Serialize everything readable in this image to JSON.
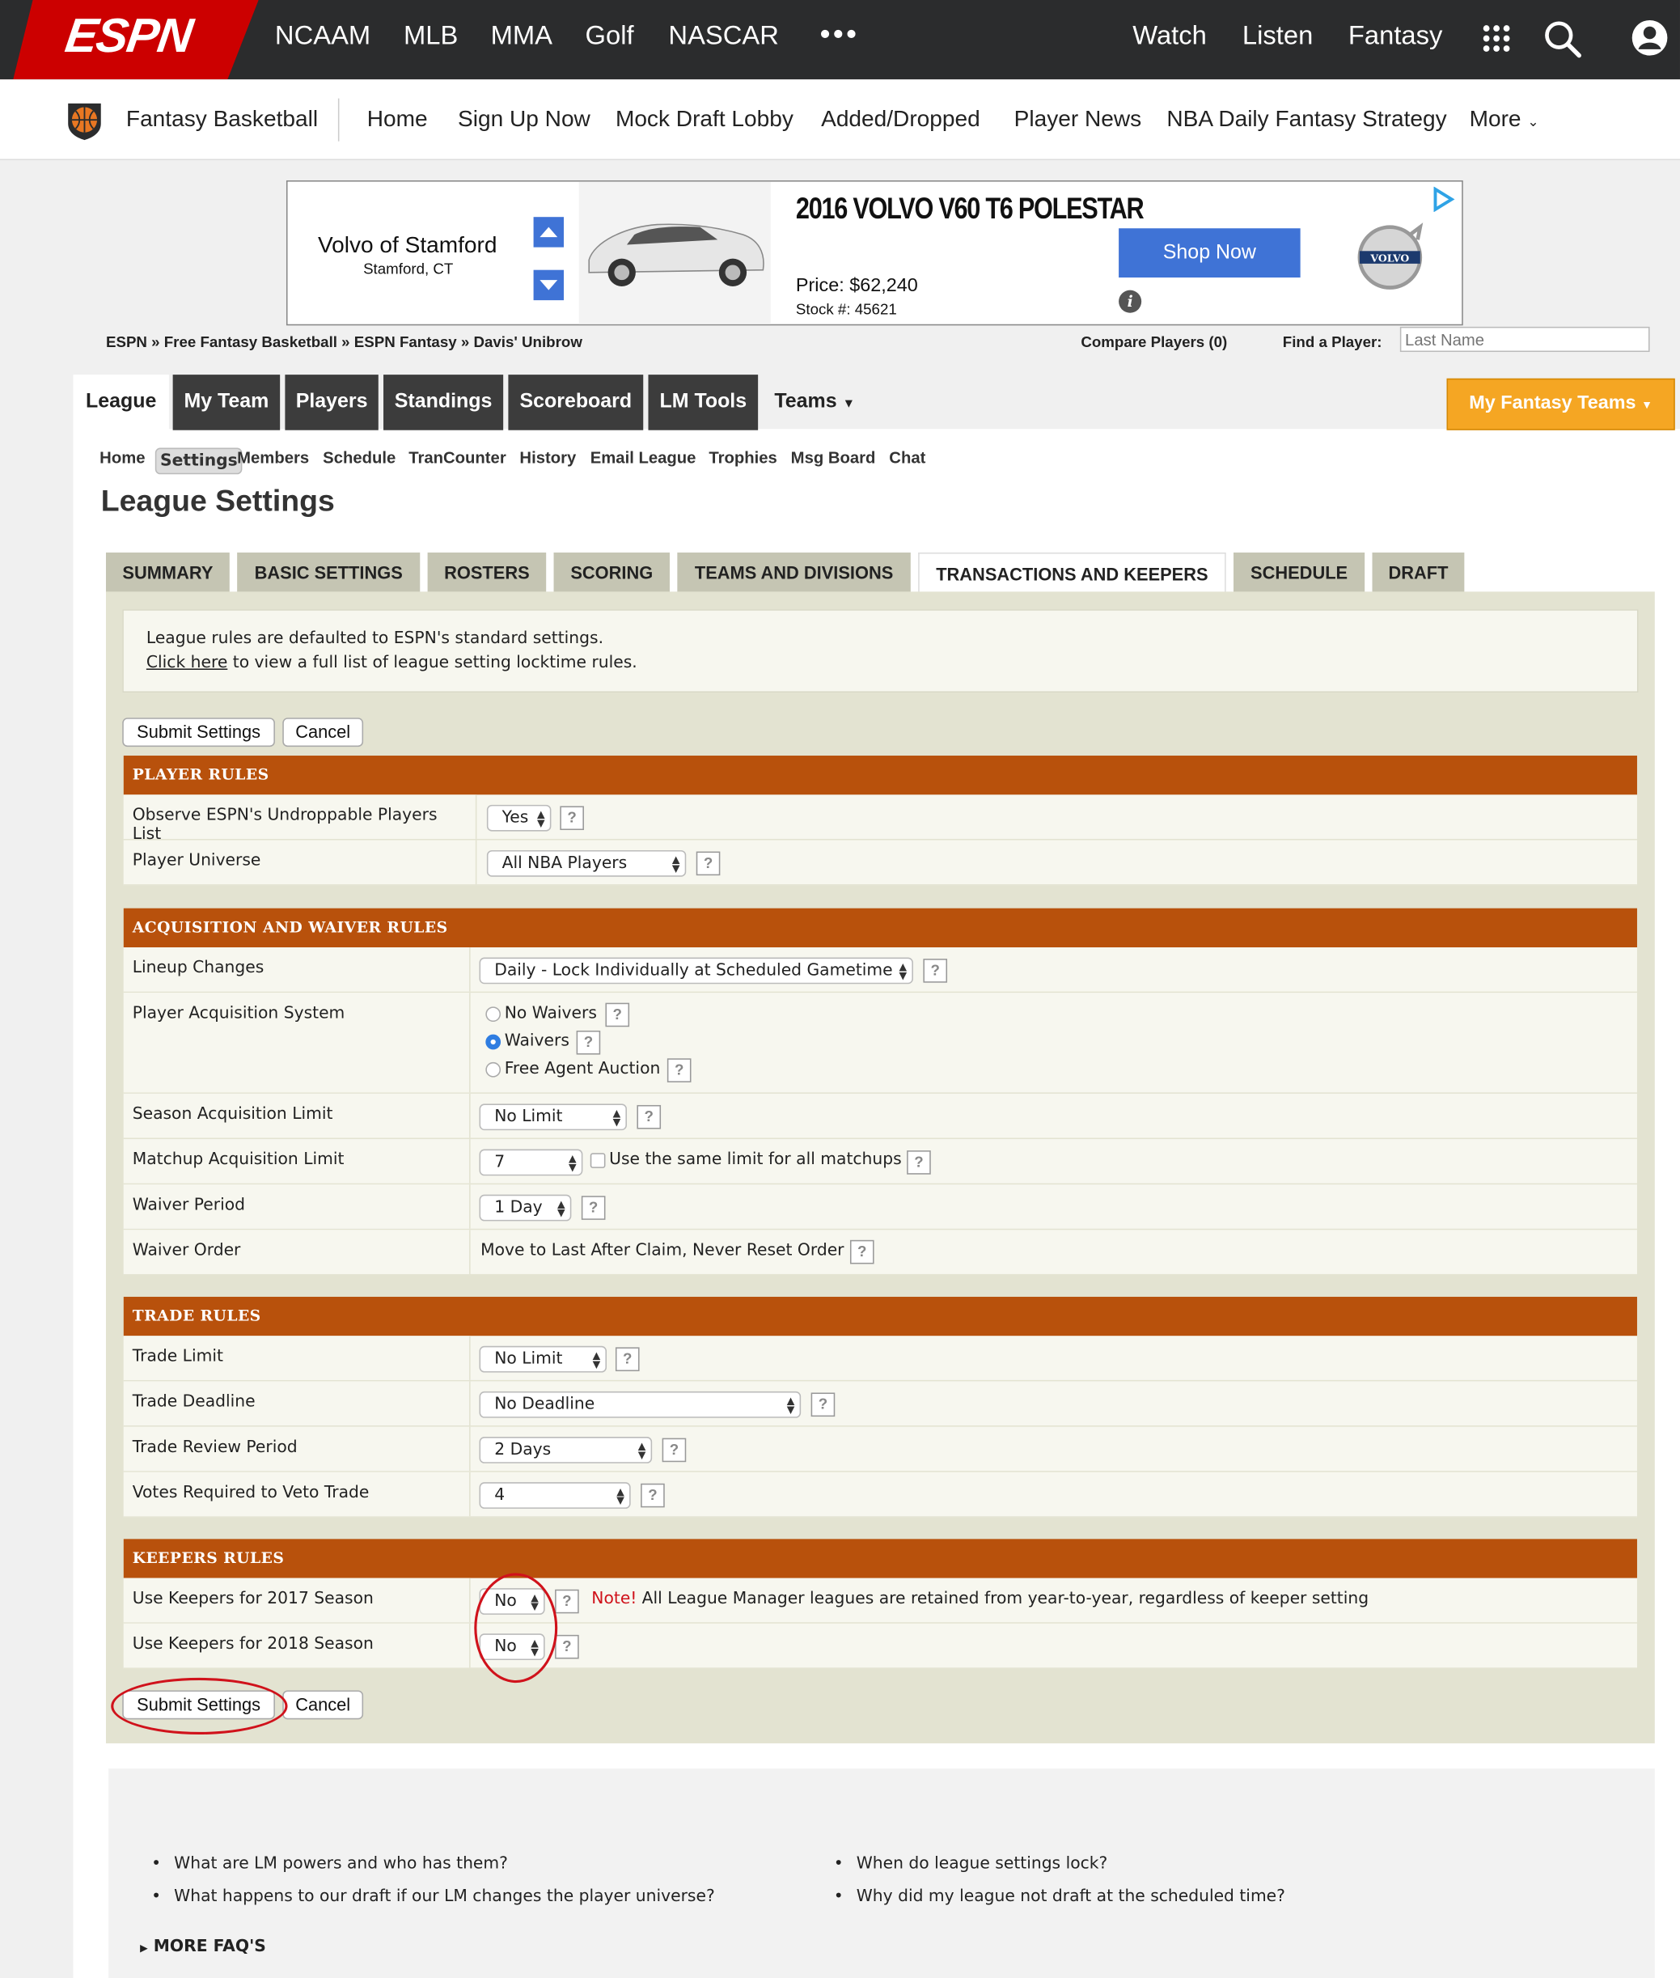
{
  "topnav": {
    "logo": "ESPN",
    "items": [
      "NCAAM",
      "MLB",
      "MMA",
      "Golf",
      "NASCAR"
    ],
    "more": "•••",
    "right": [
      "Watch",
      "Listen",
      "Fantasy"
    ]
  },
  "subnav": {
    "brand": "Fantasy Basketball",
    "links": [
      "Home",
      "Sign Up Now",
      "Mock Draft Lobby",
      "Added/Dropped",
      "Player News",
      "NBA Daily Fantasy Strategy",
      "More"
    ]
  },
  "ad": {
    "dealer": "Volvo of Stamford",
    "location": "Stamford, CT",
    "model": "2016 VOLVO V60 T6 POLESTAR",
    "price": "Price: $62,240",
    "stock": "Stock #: 45621",
    "cta": "Shop Now",
    "brand_mark": "VOLVO"
  },
  "breadcrumb": "ESPN » Free Fantasy Basketball » ESPN Fantasy » Davis' Unibrow",
  "compare": "Compare Players (0)",
  "find_label": "Find a Player:",
  "find_placeholder": "Last Name",
  "main_tabs": [
    "League",
    "My Team",
    "Players",
    "Standings",
    "Scoreboard",
    "LM Tools",
    "Teams"
  ],
  "my_fantasy_teams": "My Fantasy Teams",
  "sub_tabs": [
    "Home",
    "Settings",
    "Members",
    "Schedule",
    "TranCounter",
    "History",
    "Email League",
    "Trophies",
    "Msg Board",
    "Chat"
  ],
  "page_title": "League Settings",
  "settings_tabs": [
    "SUMMARY",
    "BASIC SETTINGS",
    "ROSTERS",
    "SCORING",
    "TEAMS AND DIVISIONS",
    "TRANSACTIONS AND KEEPERS",
    "SCHEDULE",
    "DRAFT"
  ],
  "notice": {
    "line1": "League rules are defaulted to ESPN's standard settings.",
    "link": "Click here",
    "line2_rest": " to view a full list of league setting locktime rules."
  },
  "buttons": {
    "submit": "Submit Settings",
    "cancel": "Cancel"
  },
  "sections": {
    "player_rules": {
      "title": "PLAYER RULES",
      "rows": [
        {
          "label": "Observe ESPN's Undroppable Players List",
          "value": "Yes"
        },
        {
          "label": "Player Universe",
          "value": "All NBA Players"
        }
      ]
    },
    "acquisition": {
      "title": "ACQUISITION AND WAIVER RULES",
      "lineup_label": "Lineup Changes",
      "lineup_value": "Daily - Lock Individually at Scheduled Gametime",
      "system_label": "Player Acquisition System",
      "system_options": [
        "No Waivers",
        "Waivers",
        "Free Agent Auction"
      ],
      "system_selected": "Waivers",
      "season_label": "Season Acquisition Limit",
      "season_value": "No Limit",
      "matchup_label": "Matchup Acquisition Limit",
      "matchup_value": "7",
      "matchup_same": "Use the same limit for all matchups",
      "period_label": "Waiver Period",
      "period_value": "1 Day",
      "order_label": "Waiver Order",
      "order_value": "Move to Last After Claim, Never Reset Order"
    },
    "trade": {
      "title": "TRADE RULES",
      "rows": [
        {
          "label": "Trade Limit",
          "value": "No Limit"
        },
        {
          "label": "Trade Deadline",
          "value": "No Deadline"
        },
        {
          "label": "Trade Review Period",
          "value": "2 Days"
        },
        {
          "label": "Votes Required to Veto Trade",
          "value": "4"
        }
      ]
    },
    "keepers": {
      "title": "KEEPERS RULES",
      "rows": [
        {
          "label": "Use Keepers for 2017 Season",
          "value": "No"
        },
        {
          "label": "Use Keepers for 2018 Season",
          "value": "No"
        }
      ],
      "note_label": "Note!",
      "note_text": "All League Manager leagues are retained from year-to-year, regardless of keeper setting"
    }
  },
  "faq": {
    "left": [
      "What are LM powers and who has them?",
      "What happens to our draft if our LM changes the player universe?"
    ],
    "right": [
      "When do league settings lock?",
      "Why did my league not draft at the scheduled time?"
    ],
    "more": "MORE FAQ'S"
  },
  "colors": {
    "espn_red": "#cc0000",
    "section_orange": "#b8510c",
    "my_teams_gold": "#f5a623",
    "annotation_red": "#d0121b"
  }
}
